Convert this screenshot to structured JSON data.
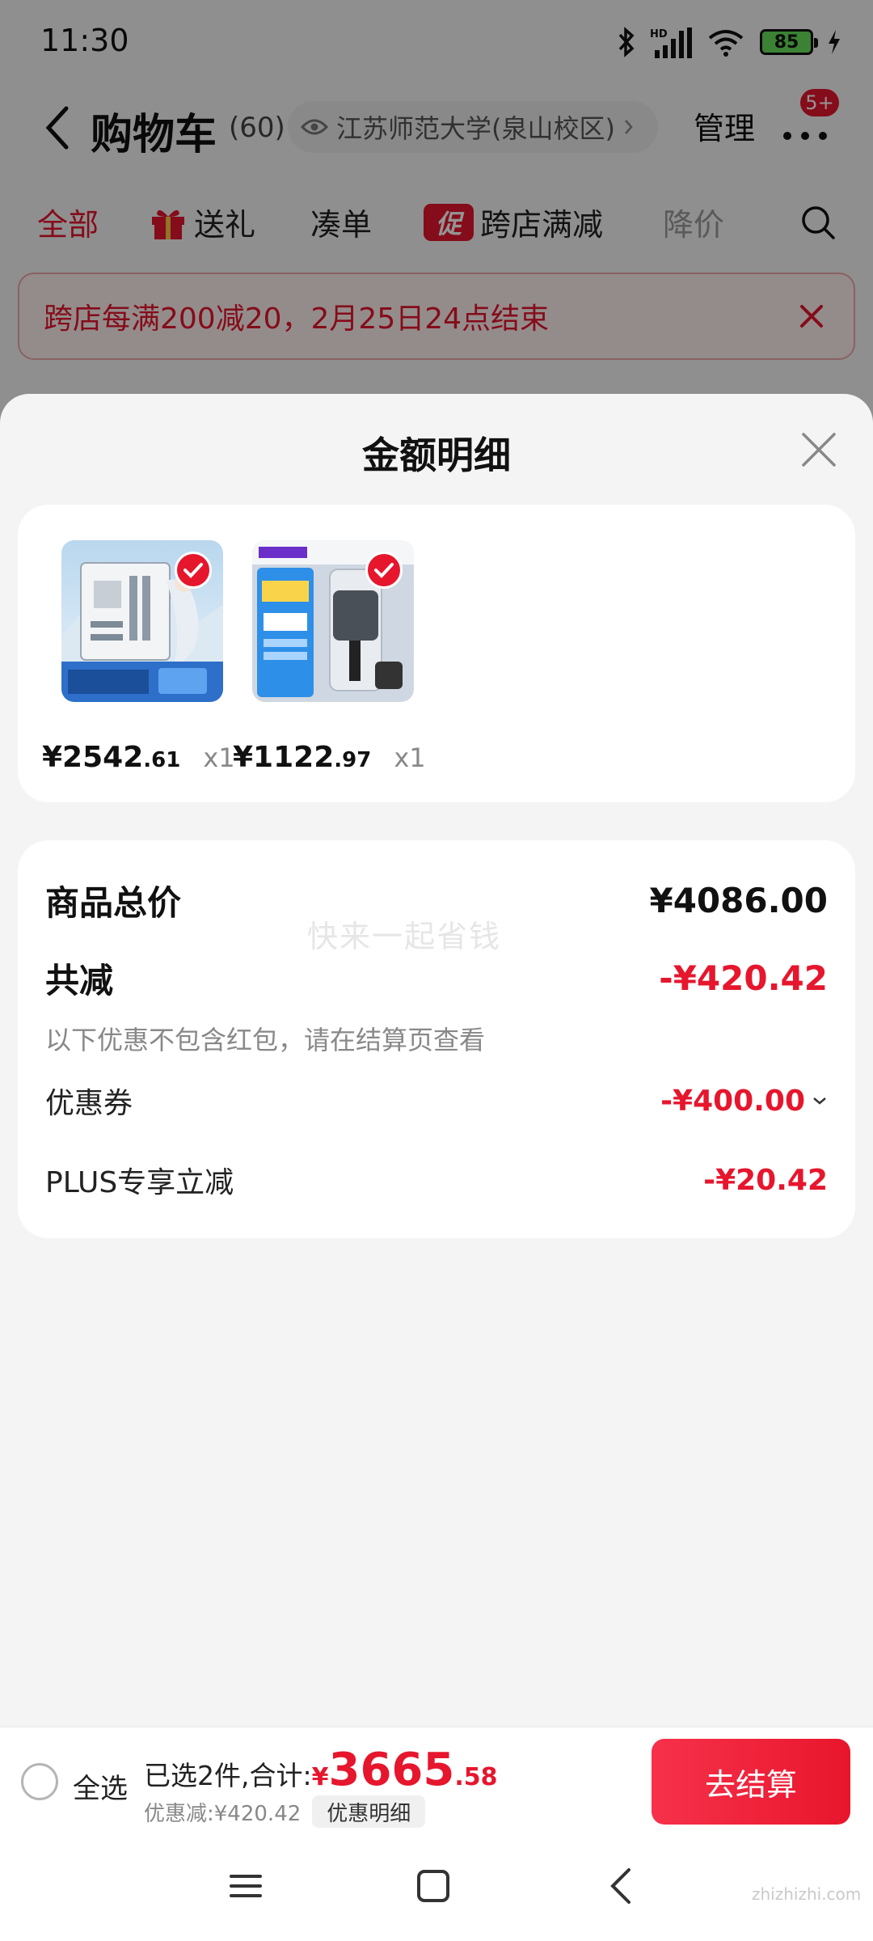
{
  "status_bar": {
    "time": "11:30",
    "battery": "85",
    "icons": [
      "bluetooth-icon",
      "hd-signal-icon",
      "wifi-icon",
      "battery-icon",
      "charging-icon"
    ]
  },
  "nav": {
    "title": "购物车",
    "count": "(60)",
    "address": "江苏师范大学(泉山校区)",
    "manage": "管理",
    "badge": "5+"
  },
  "tabs": [
    {
      "label": "全部",
      "active": true
    },
    {
      "label": "送礼",
      "icon": "gift-icon"
    },
    {
      "label": "凑单"
    },
    {
      "label": "跨店满减",
      "chip": "促"
    },
    {
      "label": "降价"
    }
  ],
  "banner": {
    "text": "跨店每满200减20，2月25日24点结束"
  },
  "sheet": {
    "title": "金额明细",
    "watermark": "快来一起省钱",
    "products": [
      {
        "price_int": "¥2542",
        "price_dec": ".61",
        "qty": "x1",
        "image": "motherboard product image"
      },
      {
        "price_int": "¥1122",
        "price_dec": ".97",
        "qty": "x1",
        "image": "phone accessory product image"
      }
    ],
    "summary": {
      "total_label": "商品总价",
      "total_value": "¥4086.00",
      "discount_label": "共减",
      "discount_value": "-¥420.42",
      "note": "以下优惠不包含红包，请在结算页查看",
      "coupon_label": "优惠券",
      "coupon_value": "-¥400.00",
      "plus_label": "PLUS专享立减",
      "plus_value": "-¥20.42"
    }
  },
  "bottom_bar": {
    "select_all": "全选",
    "summary_label": "已选2件,合计:",
    "total_symbol": "¥",
    "total_int": "3665",
    "total_dec": ".58",
    "discount_text": "优惠减:¥420.42",
    "detail_label": "优惠明细",
    "checkout": "去结算"
  },
  "site_mark": "zhizhizhi.com",
  "colors": {
    "accent": "#e6162d",
    "background": "#f4f4f4",
    "card": "#ffffff"
  }
}
